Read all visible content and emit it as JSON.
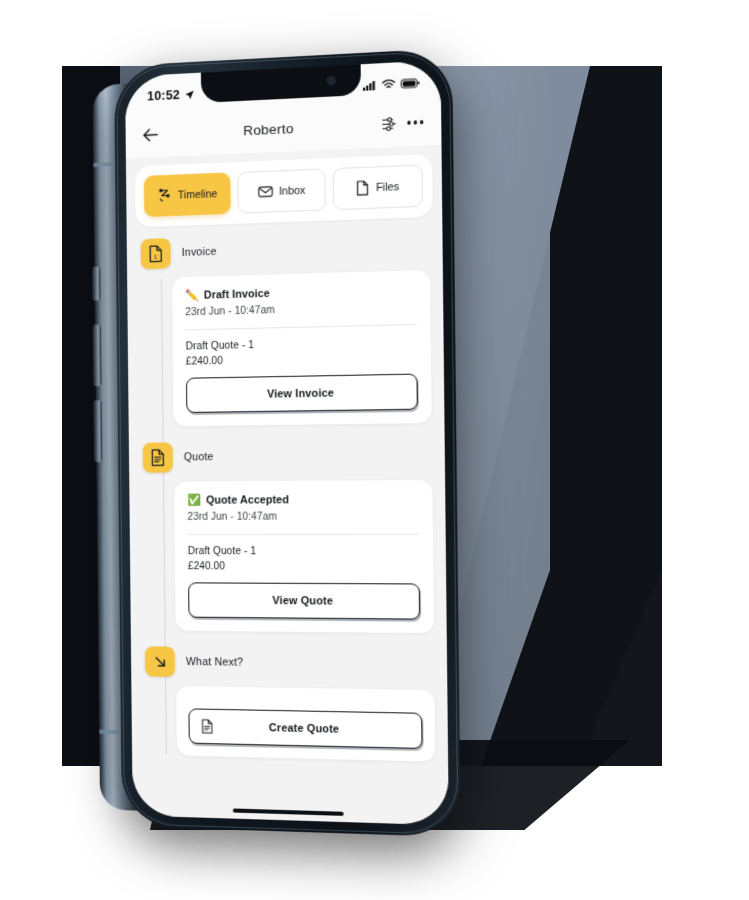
{
  "scene": {
    "background_color": "#ffffff",
    "panel_color": "#7e8c9e",
    "shadow_color": "#0a0d12"
  },
  "theme": {
    "accent": "#f7c644",
    "screen_bg": "#f3f3f3",
    "card_bg": "#ffffff",
    "text": "#16181c",
    "muted_text": "#3b3f45",
    "success": "#25b14c"
  },
  "status_bar": {
    "time": "10:52",
    "location_icon": "location-arrow-icon",
    "signal_icon": "cellular-signal-icon",
    "wifi_icon": "wifi-icon",
    "battery_icon": "battery-icon"
  },
  "header": {
    "back_icon": "back-arrow-icon",
    "title": "Roberto",
    "filter_icon": "sliders-icon",
    "more_icon": "more-options-icon"
  },
  "tabs": [
    {
      "label": "Timeline",
      "icon": "timeline-icon",
      "active": true
    },
    {
      "label": "Inbox",
      "icon": "envelope-icon",
      "active": false
    },
    {
      "label": "Files",
      "icon": "file-icon",
      "active": false
    }
  ],
  "timeline": [
    {
      "group_label": "Invoice",
      "group_icon": "invoice-document-icon",
      "card": {
        "emoji": "✏️",
        "title": "Draft Invoice",
        "timestamp": "23rd Jun - 10:47am",
        "detail_line": "Draft Quote - 1",
        "amount": "£240.00",
        "button_label": "View Invoice"
      }
    },
    {
      "group_label": "Quote",
      "group_icon": "quote-document-icon",
      "card": {
        "emoji": "✅",
        "title": "Quote Accepted",
        "timestamp": "23rd Jun - 10:47am",
        "detail_line": "Draft Quote - 1",
        "amount": "£240.00",
        "button_label": "View Quote"
      }
    },
    {
      "group_label": "What Next?",
      "group_icon": "arrow-down-right-icon",
      "card": {
        "button_icon": "document-lines-icon",
        "button_label": "Create Quote"
      }
    }
  ]
}
